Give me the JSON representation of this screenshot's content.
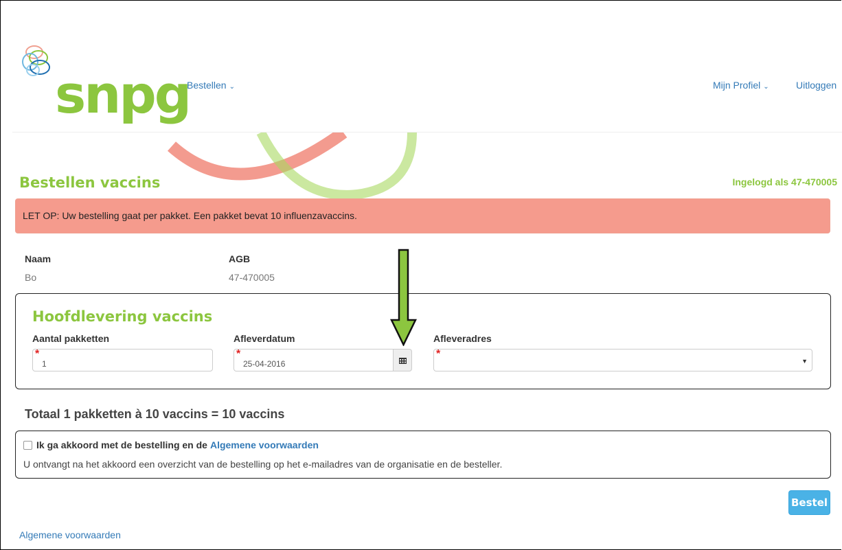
{
  "header": {
    "brand": "snpg",
    "nav_bestellen": "Bestellen",
    "nav_profiel": "Mijn Profiel",
    "nav_uitloggen": "Uitloggen"
  },
  "page": {
    "title": "Bestellen vaccins",
    "login_info": "Ingelogd als 47-470005",
    "alert": "LET OP: Uw bestelling gaat per pakket. Een pakket bevat 10 influenzavaccins."
  },
  "info": {
    "naam_label": "Naam",
    "naam_value": "Bo",
    "agb_label": "AGB",
    "agb_value": "47-470005"
  },
  "delivery": {
    "heading": "Hoofdlevering vaccins",
    "aantal_label": "Aantal pakketten",
    "aantal_value": "1",
    "datum_label": "Afleverdatum",
    "datum_value": "25-04-2016",
    "adres_label": "Afleveradres",
    "adres_value": "",
    "required_marker": "*"
  },
  "summary": {
    "total": "Totaal 1 pakketten à 10 vaccins = 10 vaccins"
  },
  "agreement": {
    "text": "Ik ga akkoord met de bestelling en de",
    "link": "Algemene voorwaarden",
    "note": "U ontvangt na het akkoord een overzicht van de bestelling op het e-mailadres van de organisatie en de besteller."
  },
  "actions": {
    "bestel_label": "Bestel"
  },
  "footer": {
    "voorwaarden_link": "Algemene voorwaarden"
  },
  "colors": {
    "brand_green": "#8cc63f",
    "alert_bg": "#f59b8d",
    "link_blue": "#337ab7",
    "button_blue": "#4ab2e6"
  }
}
